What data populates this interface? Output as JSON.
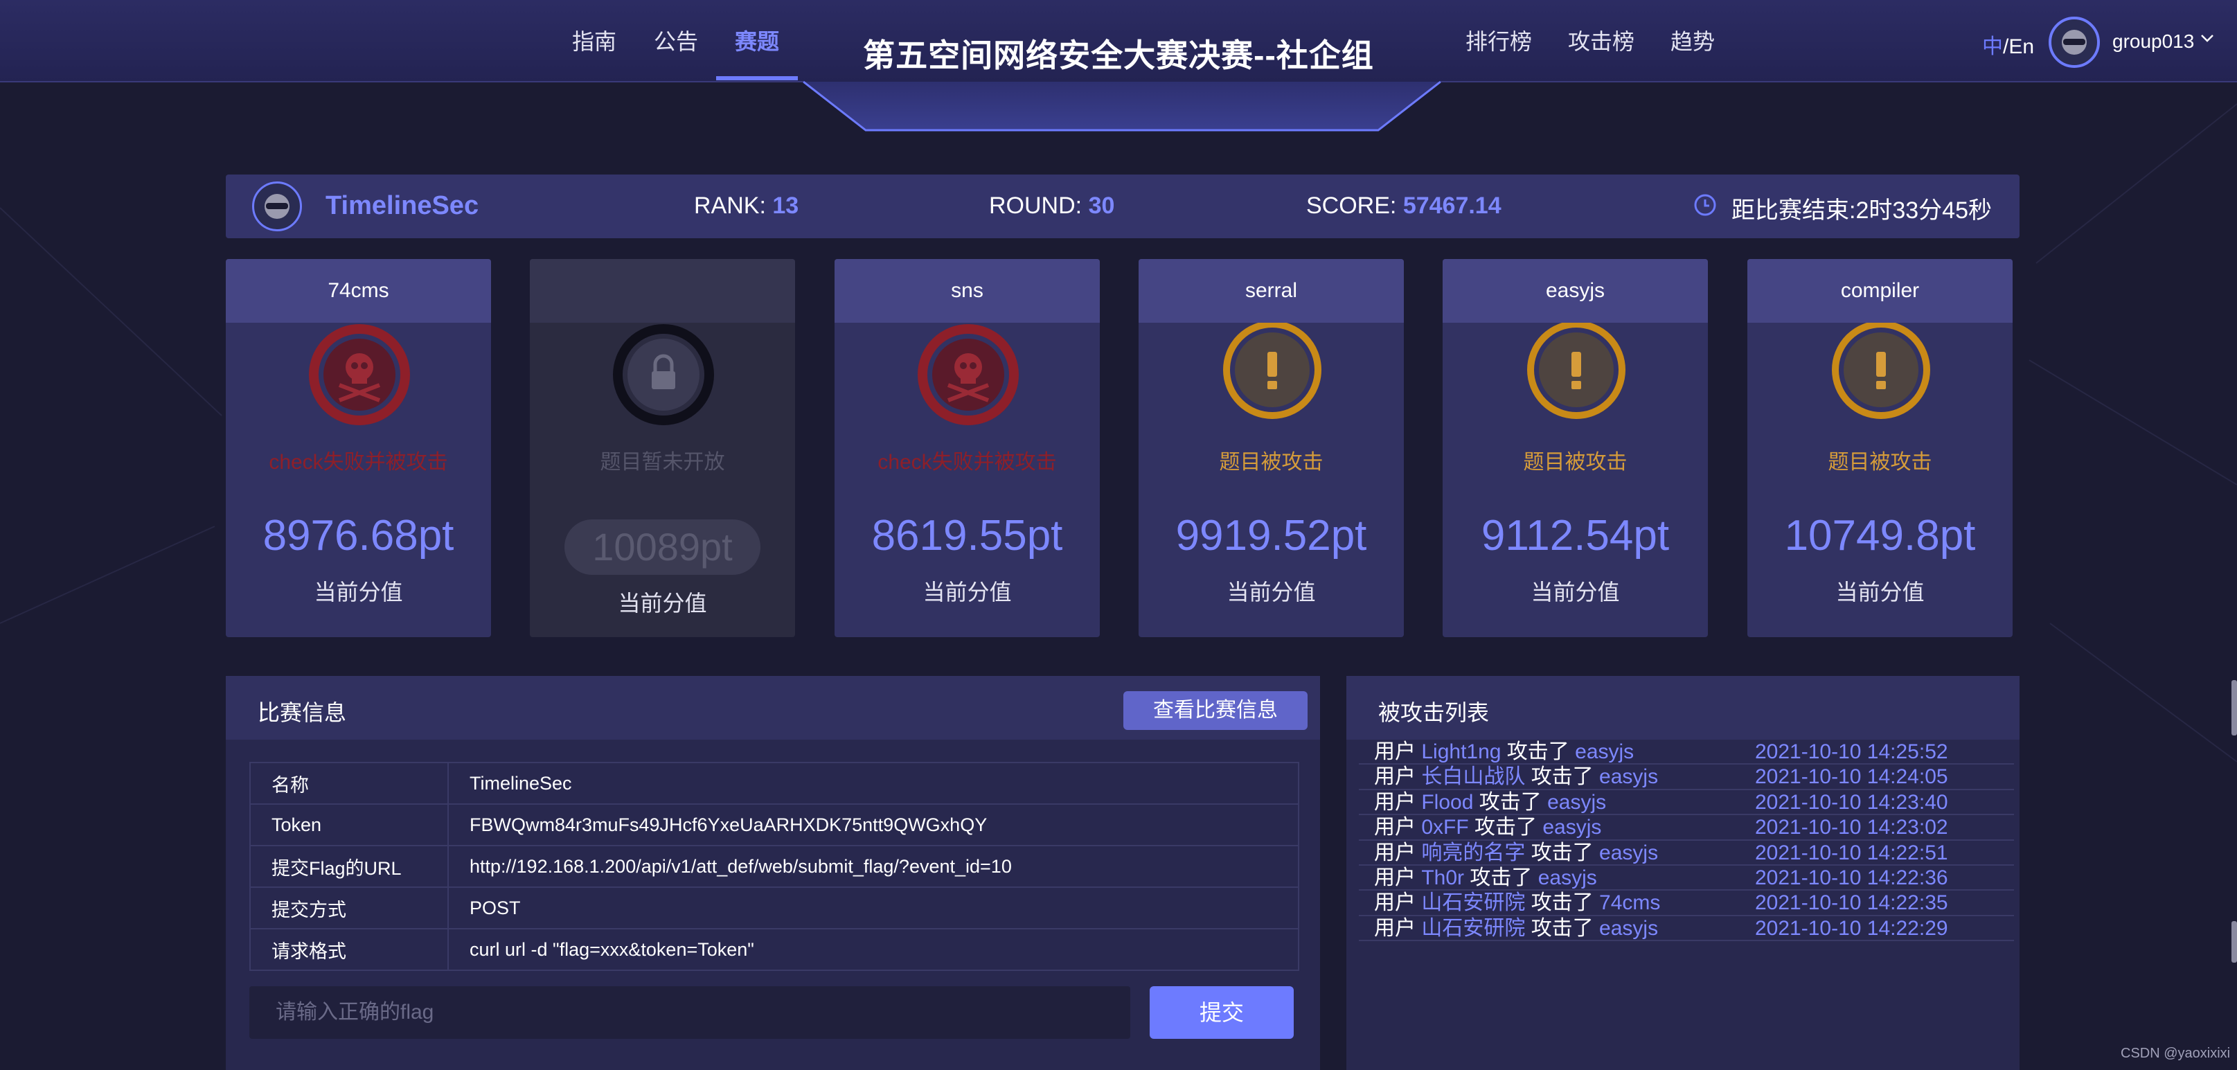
{
  "nav": {
    "left": [
      "指南",
      "公告",
      "赛题"
    ],
    "right": [
      "排行榜",
      "攻击榜",
      "趋势"
    ],
    "active": "赛题",
    "title": "第五空间网络安全大赛决赛--社企组",
    "lang_zh": "中",
    "lang_sep_en": "/En",
    "username": "group013"
  },
  "team": {
    "name": "TimelineSec",
    "rank_label": "RANK:",
    "rank": "13",
    "round_label": "ROUND:",
    "round": "30",
    "score_label": "SCORE:",
    "score": "57467.14",
    "countdown": "距比赛结束:2时33分45秒"
  },
  "challenges": [
    {
      "name": "74cms",
      "status": "check失败并被攻击",
      "state": "attacked-failed",
      "points": "8976.68pt",
      "sub": "当前分值"
    },
    {
      "name": "",
      "status": "题目暂未开放",
      "state": "locked",
      "points": "10089pt",
      "sub": "当前分值"
    },
    {
      "name": "sns",
      "status": "check失败并被攻击",
      "state": "attacked-failed",
      "points": "8619.55pt",
      "sub": "当前分值"
    },
    {
      "name": "serral",
      "status": "题目被攻击",
      "state": "attacked",
      "points": "9919.52pt",
      "sub": "当前分值"
    },
    {
      "name": "easyjs",
      "status": "题目被攻击",
      "state": "attacked",
      "points": "9112.54pt",
      "sub": "当前分值"
    },
    {
      "name": "compiler",
      "status": "题目被攻击",
      "state": "attacked",
      "points": "10749.8pt",
      "sub": "当前分值"
    }
  ],
  "match_info": {
    "title": "比赛信息",
    "view_button": "查看比赛信息",
    "rows": [
      {
        "key": "名称",
        "value": "TimelineSec"
      },
      {
        "key": "Token",
        "value": "FBWQwm84r3muFs49JHcf6YxeUaARHXDK75ntt9QWGxhQY"
      },
      {
        "key": "提交Flag的URL",
        "value": "http://192.168.1.200/api/v1/att_def/web/submit_flag/?event_id=10"
      },
      {
        "key": "提交方式",
        "value": "POST"
      },
      {
        "key": "请求格式",
        "value": "curl url -d \"flag=xxx&token=Token\""
      }
    ],
    "flag_placeholder": "请输入正确的flag",
    "submit_button": "提交"
  },
  "attack_list": {
    "title": "被攻击列表",
    "user_word": "用户",
    "verb": "攻击了",
    "rows": [
      {
        "attacker": "Light1ng",
        "target": "easyjs",
        "time": "2021-10-10 14:25:52"
      },
      {
        "attacker": "长白山战队",
        "target": "easyjs",
        "time": "2021-10-10 14:24:05"
      },
      {
        "attacker": "Flood",
        "target": "easyjs",
        "time": "2021-10-10 14:23:40"
      },
      {
        "attacker": "0xFF",
        "target": "easyjs",
        "time": "2021-10-10 14:23:02"
      },
      {
        "attacker": "响亮的名字",
        "target": "easyjs",
        "time": "2021-10-10 14:22:51"
      },
      {
        "attacker": "Th0r",
        "target": "easyjs",
        "time": "2021-10-10 14:22:36"
      },
      {
        "attacker": "山石安研院",
        "target": "74cms",
        "time": "2021-10-10 14:22:35"
      },
      {
        "attacker": "山石安研院",
        "target": "easyjs",
        "time": "2021-10-10 14:22:29"
      }
    ]
  },
  "watermark": "CSDN @yaoxixixi",
  "colors": {
    "accent": "#6d7bff",
    "attacked_failed": "#8e1f29",
    "attacked": "#d69c3a",
    "background": "#1b1b32"
  },
  "icons": {
    "attacked-failed": "skull-crossbones-icon",
    "attacked": "exclamation-icon",
    "locked": "padlock-icon"
  }
}
